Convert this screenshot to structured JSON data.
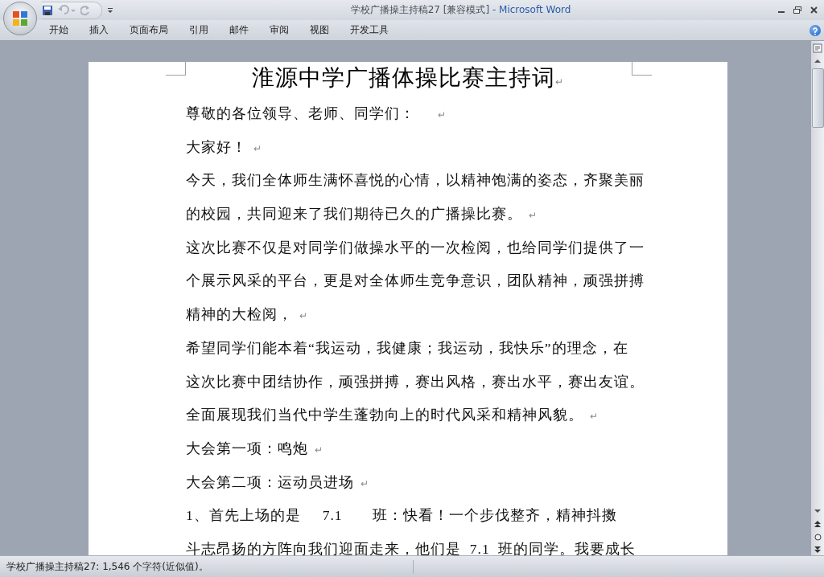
{
  "window": {
    "title": "学校广播操主持稿27 [兼容模式]",
    "separator": "-",
    "app": "Microsoft Word"
  },
  "ribbon_tabs": [
    "开始",
    "插入",
    "页面布局",
    "引用",
    "邮件",
    "审阅",
    "视图",
    "开发工具"
  ],
  "document": {
    "title": "淮源中学广播体操比赛主持词",
    "title_mark": "↵",
    "paragraphs": [
      {
        "lines": [
          "尊敬的各位领导、老师、同学们："
        ],
        "mark": "↵"
      },
      {
        "lines": [
          "大家好！"
        ],
        "mark": "↵"
      },
      {
        "lines": [
          "今天，我们全体师生满怀喜悦的心情，以精神饱满的姿态，齐聚美丽",
          "的校园，共同迎来了我们期待已久的广播操比赛。"
        ],
        "mark": "↵"
      },
      {
        "lines": [
          "这次比赛不仅是对同学们做操水平的一次检阅，也给同学们提供了一",
          "个展示风采的平台，更是对全体师生竞争意识，团队精神，顽强拼搏",
          "精神的大检阅，"
        ],
        "mark": "↵"
      },
      {
        "lines": [
          "希望同学们能本着“我运动，我健康；我运动，我快乐”的理念，在",
          "这次比赛中团结协作，顽强拼搏，赛出风格，赛出水平，赛出友谊。",
          "全面展现我们当代中学生蓬勃向上的时代风采和精神风貌。"
        ],
        "mark": "↵"
      },
      {
        "lines": [
          "大会第一项：鸣炮"
        ],
        "mark": "↵"
      },
      {
        "lines": [
          "大会第二项：运动员进场"
        ],
        "mark": "↵"
      },
      {
        "lines": [
          "1、首先上场的是     7.1       班：快看！一个步伐整齐，精神抖擞",
          "斗志昂扬的方阵向我们迎面走来，他们是  7.1  班的同学。我要成长"
        ]
      }
    ]
  },
  "status_bar": {
    "text": "学校广播操主持稿27: 1,546 个字符(近似值)。"
  }
}
